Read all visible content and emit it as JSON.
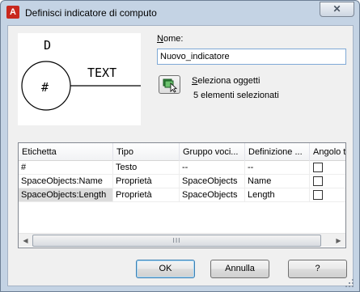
{
  "window": {
    "title": "Definisci indicatore di computo",
    "app_icon_glyph": "A",
    "close_glyph": "✕"
  },
  "preview": {
    "top_label": "D",
    "center_label": "#",
    "side_label": "TEXT"
  },
  "name_field": {
    "label_prefix": "",
    "label_underlined": "N",
    "label_rest": "ome:",
    "value": "Nuovo_indicatore"
  },
  "select_objects": {
    "label_underlined": "S",
    "label_rest": "eleziona oggetti",
    "count_text": "5 elementi selezionati",
    "icon": "select-objects-icon"
  },
  "grid": {
    "columns": [
      "Etichetta",
      "Tipo",
      "Gruppo voci...",
      "Definizione ...",
      "Angolo t"
    ],
    "rows": [
      {
        "label": "#",
        "type": "Testo",
        "group": "--",
        "definition": "--",
        "angle_checked": false
      },
      {
        "label": "SpaceObjects:Name",
        "type": "Proprietà",
        "group": "SpaceObjects",
        "definition": "Name",
        "angle_checked": false
      },
      {
        "label": "SpaceObjects:Length",
        "type": "Proprietà",
        "group": "SpaceObjects",
        "definition": "Length",
        "angle_checked": false
      }
    ]
  },
  "scrollbar": {
    "left_arrow": "◀",
    "right_arrow": "▶",
    "thumb_grip": "III"
  },
  "buttons": {
    "ok": "OK",
    "cancel": "Annulla",
    "help": "?"
  },
  "colors": {
    "title_bar": "#c4d3e4",
    "app_icon": "#c8281e",
    "input_border": "#7fa9d6",
    "selected_cell": "#dcdcdc"
  }
}
